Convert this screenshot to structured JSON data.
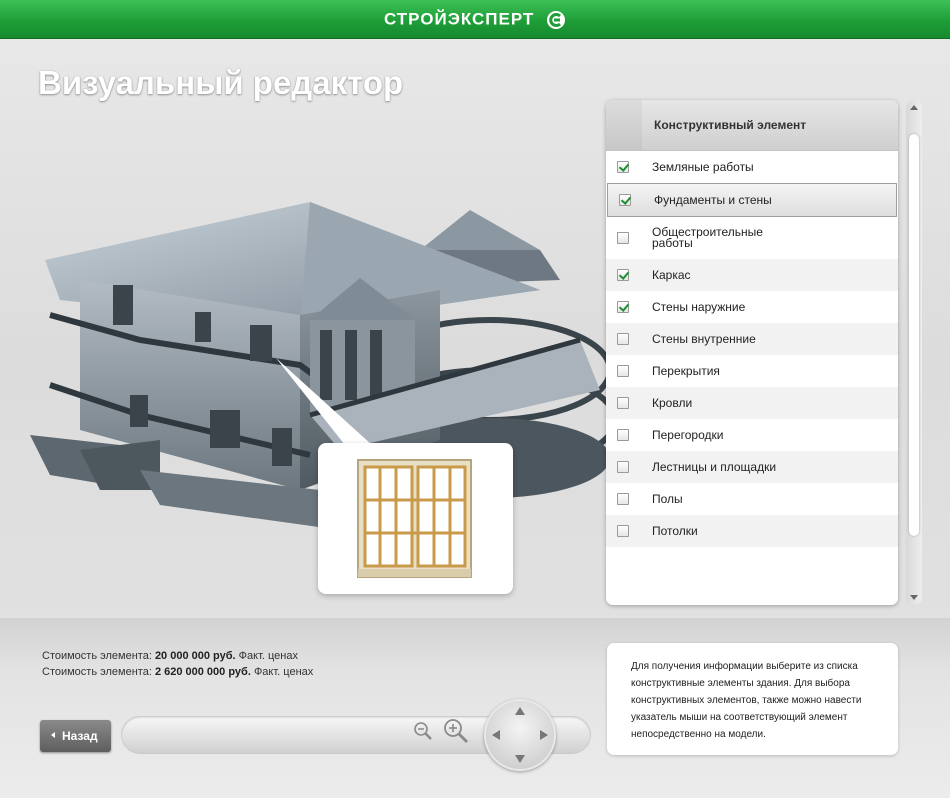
{
  "header": {
    "brand": "СТРОЙЭКСПЕРТ"
  },
  "page": {
    "title": "Визуальный редактор"
  },
  "panel": {
    "header": "Конструктивный элемент",
    "items": [
      {
        "label": "Земляные работы",
        "checked": true
      },
      {
        "label": "Фундаменты и стены",
        "checked": true,
        "selected": true
      },
      {
        "label": "Общестроительные работы",
        "checked": false
      },
      {
        "label": "Каркас",
        "checked": true
      },
      {
        "label": "Стены наружние",
        "checked": true
      },
      {
        "label": "Стены внутренние",
        "checked": false
      },
      {
        "label": "Перекрытия",
        "checked": false
      },
      {
        "label": "Кровли",
        "checked": false
      },
      {
        "label": "Перегородки",
        "checked": false
      },
      {
        "label": "Лестницы и площадки",
        "checked": false
      },
      {
        "label": "Полы",
        "checked": false
      },
      {
        "label": "Потолки",
        "checked": false
      }
    ]
  },
  "costs": [
    {
      "prefix": "Стоимость элемента: ",
      "value": "20 000 000 руб.",
      "suffix": " Факт. ценах"
    },
    {
      "prefix": "Стоимость элемента: ",
      "value": "2 620 000 000 руб.",
      "suffix": " Факт. ценах"
    }
  ],
  "info": {
    "text": "Для получения информации выберите из списка конструктивные элементы здания. Для выбора конструктивных элементов, также можно навести указатель мыши на соответствующий элемент непосредственно на модели."
  },
  "controls": {
    "back_label": "Назад"
  },
  "colors": {
    "brand_green": "#1f9e38",
    "check_green": "#1c8f2f"
  }
}
